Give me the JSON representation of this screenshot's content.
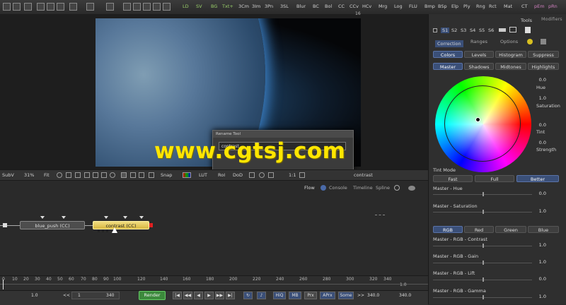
{
  "toolbar": {
    "buttons": [
      "LD",
      "SV",
      "BG",
      "Txt+",
      "3Cm",
      "3Im",
      "3Pn",
      "3SL",
      "Blur",
      "BC",
      "Bol",
      "CC",
      "CCv",
      "HCv",
      "Mrg",
      "Log",
      "FLU",
      "Bmp",
      "BSp",
      "Elp",
      "Ply",
      "Rng",
      "Rct",
      "Mat",
      "CT",
      "pEm",
      "pRn"
    ]
  },
  "viewer": {
    "frame_number": "16",
    "watermark": "www.cgtsj.com"
  },
  "rename_dialog": {
    "title": "Rename Tool",
    "value": "contrast"
  },
  "viewer_bar": {
    "subv": "SubV",
    "zoom": "31%",
    "fit": "Fit",
    "snap": "Snap",
    "lut": "LUT",
    "roi": "RoI",
    "dod": "DoD",
    "one_to_one": "1:1",
    "node_name": "contrast"
  },
  "flow_tabs": [
    "Flow",
    "Console",
    "Timeline",
    "Spline"
  ],
  "nodes": [
    {
      "label": "blue_push  (CC)"
    },
    {
      "label": "contrast  (CC)"
    }
  ],
  "timeline": {
    "ticks": [
      "0",
      "10",
      "20",
      "30",
      "40",
      "50",
      "60",
      "70",
      "80",
      "90",
      "100",
      "120",
      "140",
      "160",
      "180",
      "200",
      "220",
      "240",
      "260",
      "280",
      "300",
      "320",
      "340"
    ],
    "end_value": "1.0"
  },
  "transport": {
    "start": "1.0",
    "current": "1",
    "range_end": "340",
    "render": "Render",
    "hiq": "HiQ",
    "mb": "MB",
    "prx": "Prx",
    "aprx": "APrx",
    "some": "Some",
    "end": "340.0",
    "last": "340.0"
  },
  "panel": {
    "top_tabs": [
      "Tools",
      "Modifiers"
    ],
    "slots": [
      "S1",
      "S2",
      "S3",
      "S4",
      "S5",
      "S6"
    ],
    "tabs": [
      "Correction",
      "Ranges",
      "Options"
    ],
    "mode_buttons": [
      "Colors",
      "Levels",
      "Histogram",
      "Suppress"
    ],
    "range_buttons": [
      "Master",
      "Shadows",
      "Midtones",
      "Highlights"
    ],
    "wheel_fields": [
      {
        "label": "Hue",
        "value": "0.0"
      },
      {
        "label": "Saturation",
        "value": "1.0"
      },
      {
        "label": "Tint",
        "value": "0.0"
      },
      {
        "label": "Strength",
        "value": "0.0"
      }
    ],
    "tint_mode": {
      "label": "Tint Mode",
      "options": [
        "Fast",
        "Full",
        "Better"
      ],
      "selected": "Better"
    },
    "sliders_a": [
      {
        "label": "Master - Hue",
        "value": "0.0"
      },
      {
        "label": "Master - Saturation",
        "value": "1.0"
      }
    ],
    "channel_buttons": [
      "RGB",
      "Red",
      "Green",
      "Blue"
    ],
    "sliders_b": [
      {
        "label": "Master - RGB - Contrast",
        "value": "1.0"
      },
      {
        "label": "Master - RGB - Gain",
        "value": "1.0"
      },
      {
        "label": "Master - RGB - Lift",
        "value": "0.0"
      },
      {
        "label": "Master - RGB - Gamma",
        "value": "1.0"
      }
    ]
  },
  "colors": {
    "selected_node": "#e4c85a",
    "accent_blue": "#3a4f78",
    "watermark": "#ffe600"
  }
}
